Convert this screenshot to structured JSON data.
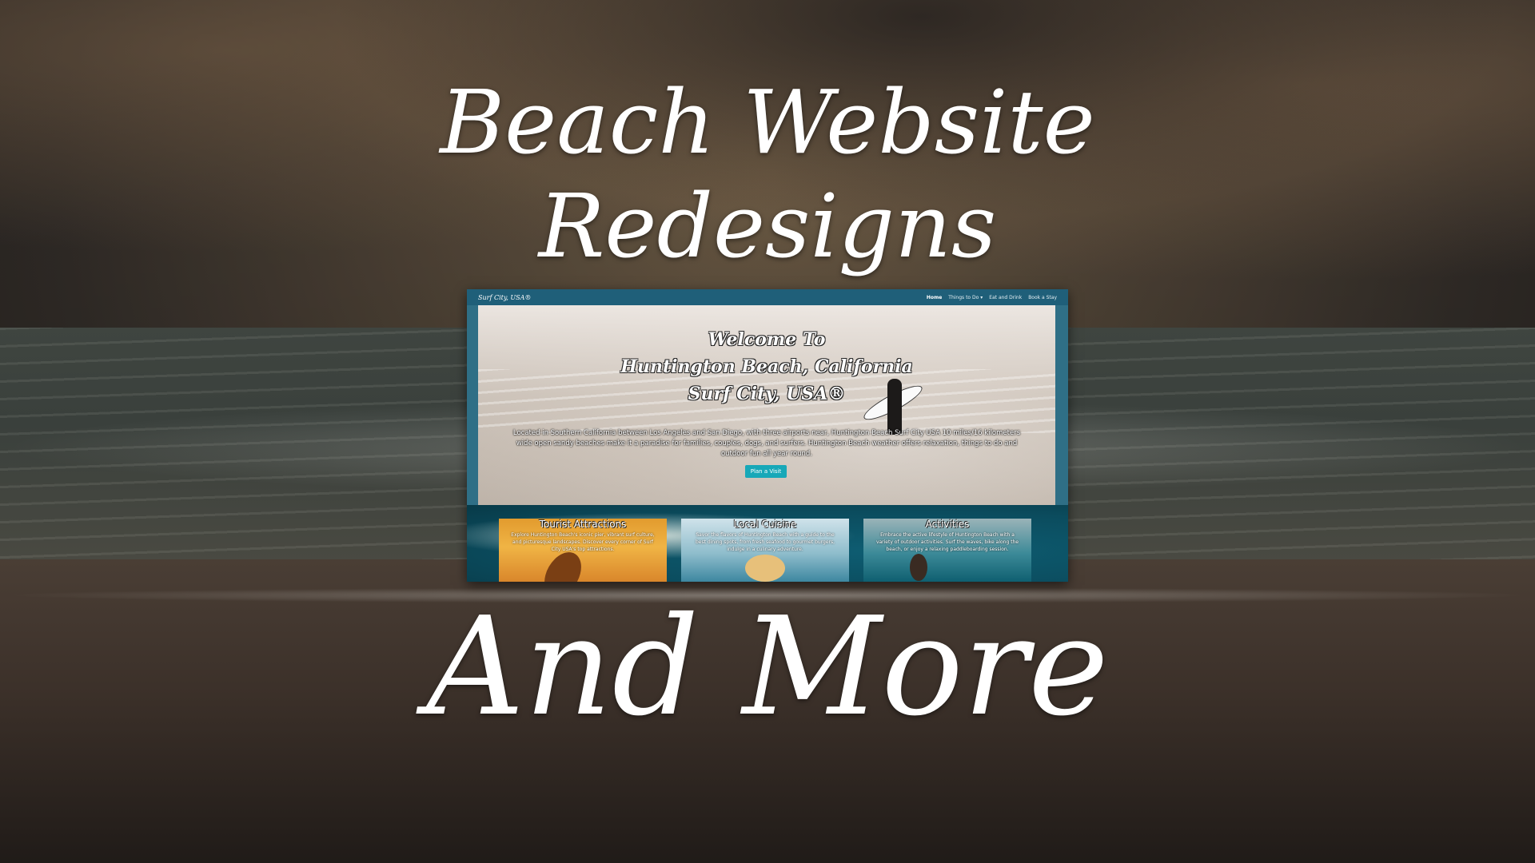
{
  "headline": {
    "line1": "Beach Website",
    "line2": "Redesigns",
    "line3": "And More"
  },
  "website": {
    "brand": "Surf City, USA®",
    "nav": [
      "Home",
      "Things to Do ▾",
      "Eat and Drink",
      "Book a Stay"
    ],
    "hero": {
      "line1": "Welcome To",
      "line2": "Huntington Beach, California",
      "line3": "Surf City, USA®",
      "description": "Located in Southern California between Los Angeles and San Diego, with three airports near, Huntington Beach Surf City USA 10 miles/16 kilometers wide open sandy beaches make it a paradise for families, couples, dogs, and surfers. Huntington Beach weather offers relaxation, things to do and outdoor fun all year round.",
      "button": "Plan a Visit"
    },
    "cards": [
      {
        "title": "Tourist Attractions",
        "text": "Explore Huntington Beach's iconic pier, vibrant surf culture, and picturesque landscapes. Discover every corner of Surf City USA's top attractions."
      },
      {
        "title": "Local Cuisine",
        "text": "Savor the flavors of Huntington Beach with a guide to the best dining spots, from fresh seafood to gourmet burgers, indulge in a culinary adventure."
      },
      {
        "title": "Activities",
        "text": "Embrace the active lifestyle of Huntington Beach with a variety of outdoor activities. Surf the waves, bike along the beach, or enjoy a relaxing paddleboarding session."
      }
    ]
  },
  "colors": {
    "nav_bg": "#1f5f79",
    "button": "#17a8b8",
    "text": "#ffffff"
  }
}
